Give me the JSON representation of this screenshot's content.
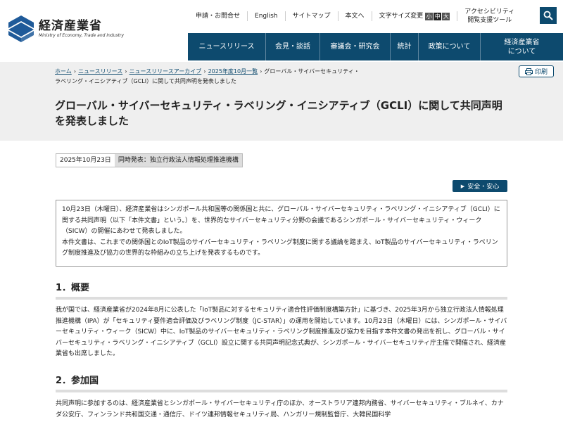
{
  "header": {
    "logo_jp": "経済産業省",
    "logo_en": "Ministry of Economy, Trade and Industry",
    "util_links": [
      "申請・お問合せ",
      "English",
      "サイトマップ",
      "本文へ"
    ],
    "fontsize_label": "文字サイズ変更",
    "fontsize_options": [
      "小",
      "中",
      "大"
    ],
    "accessibility": [
      "アクセシビリティ",
      "閲覧支援ツール"
    ],
    "search_icon": "search-icon",
    "nav": [
      "ニュースリリース",
      "会見・談話",
      "審議会・研究会",
      "統計",
      "政策について",
      "経済産業省",
      "について"
    ]
  },
  "breadcrumb": {
    "items": [
      "ホーム",
      "ニュースリリース",
      "ニュースリリースアーカイブ",
      "2025年度10月一覧"
    ],
    "current_line1": "グローバル・サイバーセキュリティ・",
    "current_line2": "ラベリング・イニシアティブ（GCLI）に関して共同声明を発表しました"
  },
  "print_label": "印刷",
  "title": "グローバル・サイバーセキュリティ・ラベリング・イニシアティブ（GCLI）に関して共同声明を発表しました",
  "meta": {
    "date": "2025年10月23日",
    "joint": "同時発表：独立行政法人情報処理推進機構"
  },
  "tag": "安全・安心",
  "summary": "10月23日（木曜日）、経済産業省はシンガポール共和国等の関係国と共に、グローバル・サイバーセキュリティ・ラベリング・イニシアティブ（GCLI）に関する共同声明（以下「本件文書」という。）を、世界的なサイバーセキュリティ分野の会議であるシンガポール・サイバーセキュリティ・ウィーク（SICW）の開催にあわせて発表しました。\n本件文書は、これまでの関係国とのIoT製品のサイバーセキュリティ・ラベリング制度に関する議論を踏まえ、IoT製品のサイバーセキュリティ・ラベリング制度推進及び協力の世界的な枠組みの立ち上げを発表するものです。",
  "section1": {
    "heading": "1．概要",
    "body": "我が国では、経済産業省が2024年8月に公表した「IoT製品に対するセキュリティ適合性評価制度構築方針」に基づき、2025年3月から独立行政法人情報処理推進機構（IPA）が「セキュリティ要件適合評価及びラベリング制度（JC-STAR）」の運用を開始しています。10月23日（木曜日）には、シンガポール・サイバーセキュリティ・ウィーク（SICW）中に、IoT製品のサイバーセキュリティ・ラベリング制度推進及び協力を目指す本件文書の発出を祝し、グローバル・サイバーセキュリティ・ラベリング・イニシアティブ（GCLI）設立に関する共同声明記念式典が、シンガポール・サイバーセキュリティ庁主催で開催され、経済産業省も出席しました。"
  },
  "section2": {
    "heading": "2．参加国",
    "body": "共同声明に参加するのは、経済産業省とシンガポール・サイバーセキュリティ庁のほか、オーストラリア連邦内務省、サイバーセキュリティ・ブルネイ、カナダ公安庁、フィンランド共和国交通・通信庁、ドイツ連邦情報セキュリティ局、ハンガリー規制監督庁、大韓民国科学"
  }
}
